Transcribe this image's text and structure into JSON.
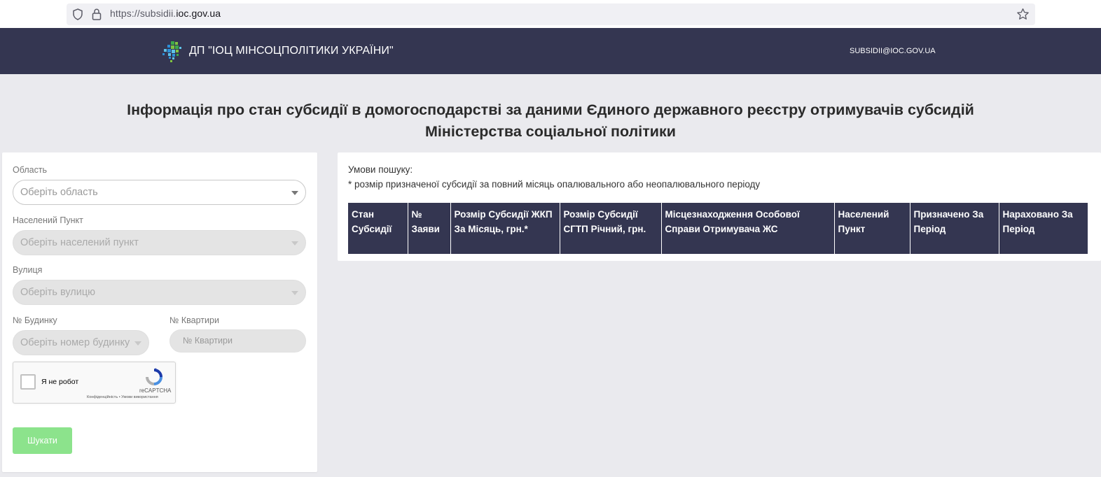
{
  "browser": {
    "url_prefix": "https://subsidii.",
    "url_domain": "ioc.gov.ua"
  },
  "header": {
    "title": "ДП \"ІОЦ МІНСОЦПОЛІТИКИ УКРАЇНИ\"",
    "email": "SUBSIDII@IOC.GOV.UA"
  },
  "page": {
    "heading_line1": "Інформація про стан субсидії в домогосподарстві за даними Єдиного державного реєстру отримувачів субсидій",
    "heading_line2": "Міністерства соціальної політики"
  },
  "form": {
    "region_label": "Область",
    "region_placeholder": "Оберіть область",
    "city_label": "Населений Пункт",
    "city_placeholder": "Оберіть населений пункт",
    "street_label": "Вулиця",
    "street_placeholder": "Оберіть вулицю",
    "house_label": "№ Будинку",
    "house_placeholder": "Оберіть номер будинку",
    "apartment_label": "№ Квартири",
    "apartment_placeholder": "№ Квартири",
    "captcha_label": "Я не робот",
    "captcha_brand": "reCAPTCHA",
    "captcha_links": "Конфіденційність • Умови використання",
    "search_button": "Шукати"
  },
  "results": {
    "conditions_title": "Умови пошуку:",
    "conditions_note": "* розмір призначеної субсидії за повний місяць опалювального або неопалювального періоду",
    "columns": [
      "Стан Субсидії",
      "№ Заяви",
      "Розмір Субсидії ЖКП За Місяць, грн.*",
      "Розмір Субсидії СГТП Річний, грн.",
      "Місцезнаходження Особової Справи Отримувача ЖС",
      "Населений Пункт",
      "Призначено За Період",
      "Нараховано За Період"
    ]
  },
  "colors": {
    "header_bg": "#343651",
    "page_bg": "#eaeaee",
    "search_button_bg": "#8ce38c"
  },
  "icons": [
    "shield-icon",
    "lock-icon",
    "star-icon",
    "logo-icon",
    "chevron-down-icon",
    "recaptcha-logo-icon"
  ]
}
